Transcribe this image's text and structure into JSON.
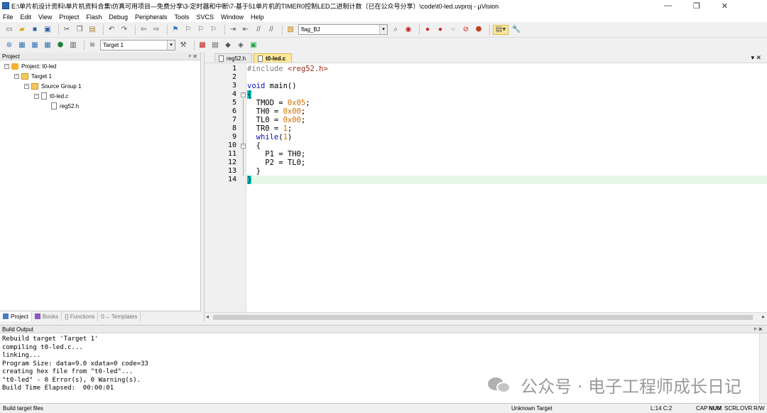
{
  "window": {
    "title": "E:\\单片机设计资料\\单片机资料合集\\仿真可用项目—免费分享\\3-定时器和中断\\7-基于51单片机的TIMER0控制LED二进制计数（已在公众号分享）\\code\\t0-led.uvproj - µVision",
    "minimize": "—",
    "restore": "❐",
    "close": "✕"
  },
  "menu": [
    "File",
    "Edit",
    "View",
    "Project",
    "Flash",
    "Debug",
    "Peripherals",
    "Tools",
    "SVCS",
    "Window",
    "Help"
  ],
  "toolbar": {
    "find_combo": "flag_BJ",
    "target_combo": "Target 1"
  },
  "project_pane": {
    "title": "Project",
    "header_controls": "ᵖ ✕",
    "tree": [
      {
        "label": "Project: t0-led",
        "toggle": "−",
        "icon": "project"
      },
      {
        "label": "Target 1",
        "toggle": "−",
        "icon": "target"
      },
      {
        "label": "Source Group 1",
        "toggle": "−",
        "icon": "folder"
      },
      {
        "label": "t0-led.c",
        "toggle": "−",
        "icon": "file"
      },
      {
        "label": "reg52.h",
        "toggle": "",
        "icon": "file"
      }
    ],
    "tabs": [
      {
        "label": "Project",
        "active": true
      },
      {
        "label": "Books",
        "active": false
      },
      {
        "label": "{} Functions",
        "active": false
      },
      {
        "label": "0→ Templates",
        "active": false
      }
    ]
  },
  "editor": {
    "tabs": [
      {
        "label": "reg52.h",
        "active": false
      },
      {
        "label": "t0-led.c",
        "active": true
      }
    ],
    "tab_controls": "▾ ✕",
    "line_numbers": [
      "1",
      "2",
      "3",
      "4",
      "5",
      "6",
      "7",
      "8",
      "9",
      "10",
      "11",
      "12",
      "13",
      "14"
    ],
    "code": {
      "l1_pp": "#include ",
      "l1_str": "<reg52.h>",
      "l3_kw": "void",
      "l3_rest": " main()",
      "l4": "{",
      "l5_a": "  TMOD = ",
      "l5_n": "0x05",
      "l5_b": ";",
      "l6_a": "  TH0 = ",
      "l6_n": "0x00",
      "l6_b": ";",
      "l7_a": "  TL0 = ",
      "l7_n": "0x00",
      "l7_b": ";",
      "l8_a": "  TR0 = ",
      "l8_n": "1",
      "l8_b": ";",
      "l9_kw": "  while",
      "l9_a": "(",
      "l9_n": "1",
      "l9_b": ")",
      "l10": "  {",
      "l11": "    P1 = TH0;",
      "l12": "    P2 = TL0;",
      "l13": "  }",
      "l14": "}"
    }
  },
  "build_output": {
    "title": "Build Output",
    "header_controls": "ᵖ ✕",
    "lines": [
      "Rebuild target 'Target 1'",
      "compiling t0-led.c...",
      "linking...",
      "Program Size: data=9.0 xdata=0 code=33",
      "creating hex file from \"t0-led\"...",
      "\"t0-led\" - 0 Error(s), 0 Warning(s).",
      "Build Time Elapsed:  00:00:01"
    ]
  },
  "watermark": "公众号 · 电子工程师成长日记",
  "status": {
    "left": "Build target files",
    "target": "Unknown Target",
    "position": "L:14 C:2",
    "flags": [
      "CAP",
      "NUM",
      "SCRL",
      "OVR",
      "R/W"
    ]
  }
}
